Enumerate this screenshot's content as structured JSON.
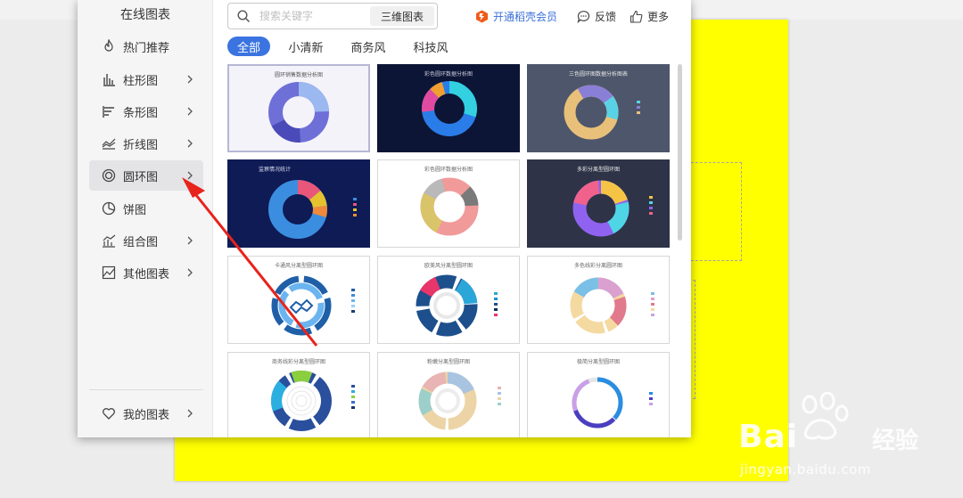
{
  "sidebar": {
    "title": "在线图表",
    "items": [
      {
        "label": "热门推荐",
        "icon": "flame-icon"
      },
      {
        "label": "柱形图",
        "icon": "column-chart-icon"
      },
      {
        "label": "条形图",
        "icon": "bar-chart-icon"
      },
      {
        "label": "折线图",
        "icon": "line-chart-icon"
      },
      {
        "label": "圆环图",
        "icon": "donut-chart-icon"
      },
      {
        "label": "饼图",
        "icon": "pie-chart-icon"
      },
      {
        "label": "组合图",
        "icon": "combo-chart-icon"
      },
      {
        "label": "其他图表",
        "icon": "other-chart-icon"
      }
    ],
    "active_item": "圆环图",
    "my_charts": {
      "label": "我的图表",
      "icon": "heart-icon"
    }
  },
  "search": {
    "placeholder": "搜索关键字",
    "button": "三维图表"
  },
  "top_links": {
    "member": "开通稻壳会员",
    "feedback": "反馈",
    "more": "更多"
  },
  "filter_tabs": [
    "全部",
    "小清新",
    "商务风",
    "科技风"
  ],
  "active_tab": "全部",
  "templates": [
    {
      "title": "圆环销售数据分析图"
    },
    {
      "title": "彩色圆环数据分析图"
    },
    {
      "title": "三色圆环图数据分析图表"
    },
    {
      "title": "监察情况统计"
    },
    {
      "title": "彩色圆环数据分析图"
    },
    {
      "title": "多彩分离型圆环图"
    },
    {
      "title": "卡通风分离型圆环图"
    },
    {
      "title": "欧美风分离型圆环图"
    },
    {
      "title": "多色线彩分离圆环图"
    },
    {
      "title": "商务线彩分离型圆环图"
    },
    {
      "title": "粉嫩分离型圆环图"
    },
    {
      "title": "极简分离型圆环图"
    }
  ],
  "watermark": {
    "brand": "Bai",
    "brand_cn": "经验",
    "url": "jingyan.baidu.com"
  },
  "colors": {
    "accent": "#3b74e0",
    "member": "#3b6fd8",
    "arrow": "#e8231b",
    "page": "#ffff00"
  }
}
